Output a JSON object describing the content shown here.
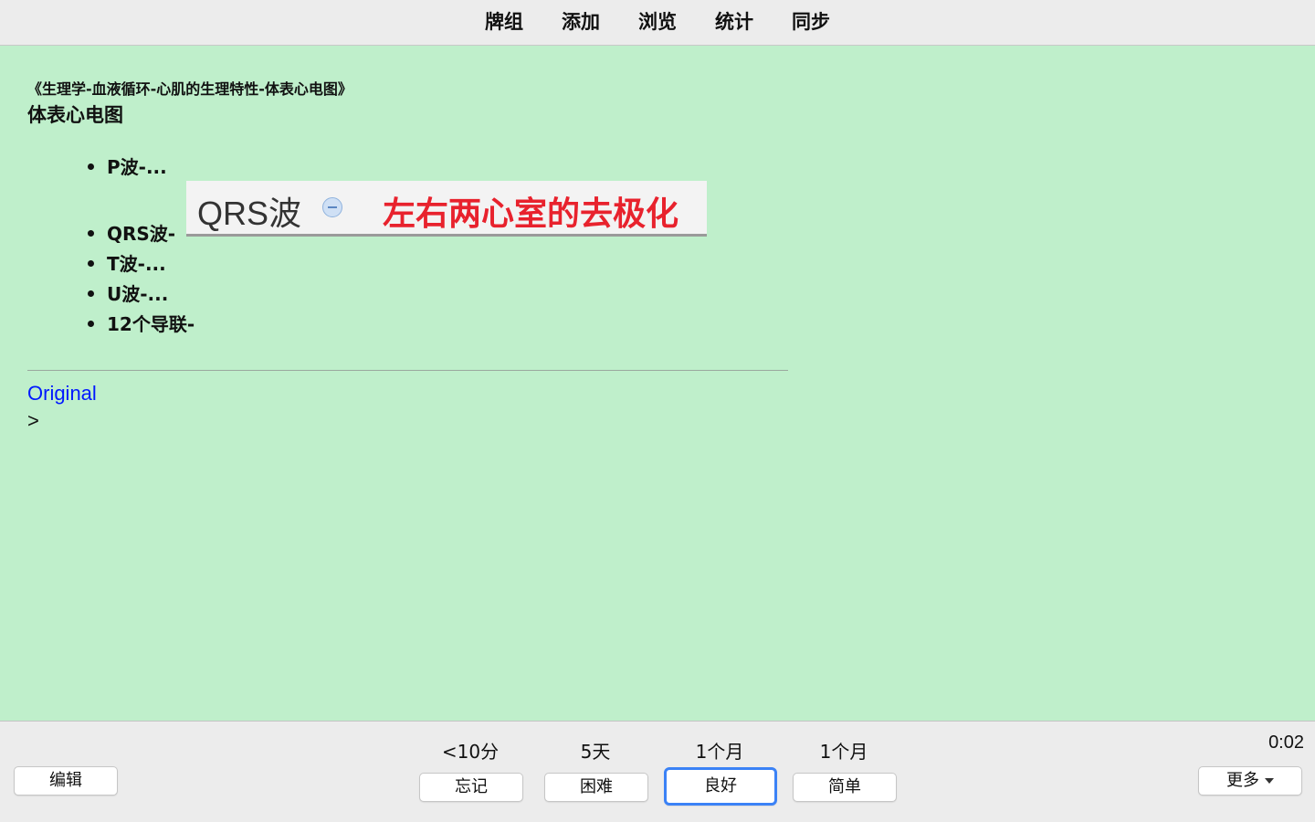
{
  "nav": {
    "items": [
      "牌组",
      "添加",
      "浏览",
      "统计",
      "同步"
    ]
  },
  "card": {
    "deck_path": "《生理学-血液循环-心肌的生理特性-体表心电图》",
    "title": "体表心电图",
    "bullets": [
      "P波-...",
      "QRS波-",
      "T波-...",
      "U波-...",
      "12个导联-"
    ],
    "popup": {
      "term": "QRS波",
      "collapse_icon": "minus-circle-icon",
      "definition": "左右两心室的去极化",
      "definition_color": "#e8222d"
    },
    "original_link": "Original",
    "gt": ">"
  },
  "bottom": {
    "edit_label": "编辑",
    "more_label": "更多",
    "timer": "0:02",
    "answers": [
      {
        "interval": "<10分",
        "label": "忘记"
      },
      {
        "interval": "5天",
        "label": "困难"
      },
      {
        "interval": "1个月",
        "label": "良好"
      },
      {
        "interval": "1个月",
        "label": "简单"
      }
    ],
    "selected_color": "#3b82f6"
  },
  "colors": {
    "card_background": "#bfefcb",
    "link": "#0018ff"
  }
}
